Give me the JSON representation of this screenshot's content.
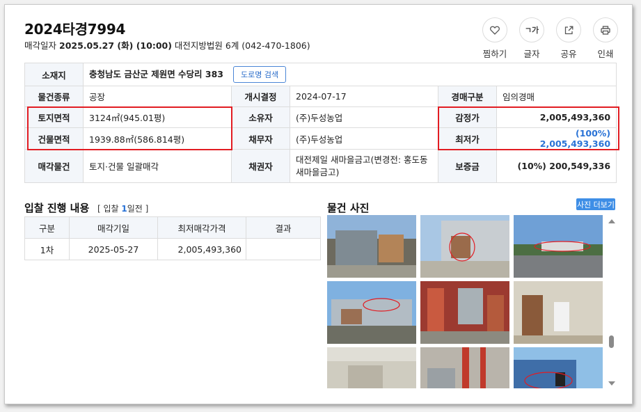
{
  "header": {
    "case_no": "2024타경7994",
    "sale_label": "매각일자",
    "sale_datetime": "2025.05.27 (화) (10:00)",
    "court": "대전지방법원 6계 (042-470-1806)"
  },
  "actions": [
    {
      "label": "찜하기",
      "icon": "heart-icon"
    },
    {
      "label": "글자",
      "icon": "text-size-icon",
      "glyph": "ㄱ가"
    },
    {
      "label": "공유",
      "icon": "share-icon"
    },
    {
      "label": "인쇄",
      "icon": "print-icon"
    }
  ],
  "info": {
    "address_label": "소재지",
    "address": "충청남도 금산군 제원면 수당리 383",
    "road_btn": "도로명 검색",
    "rows": [
      {
        "l1": "물건종류",
        "v1": "공장",
        "l2": "개시결정",
        "v2": "2024-07-17",
        "l3": "경매구분",
        "v3": "임의경매"
      },
      {
        "l1": "토지면적",
        "v1": "3124㎡(945.01평)",
        "l2": "소유자",
        "v2": "(주)두성농업",
        "l3": "감정가",
        "v3": "2,005,493,360"
      },
      {
        "l1": "건물면적",
        "v1": "1939.88㎡(586.814평)",
        "l2": "채무자",
        "v2": "(주)두성농업",
        "l3": "최저가",
        "v3": "(100%) 2,005,493,360"
      },
      {
        "l1": "매각물건",
        "v1": "토지·건물 일괄매각",
        "l2": "채권자",
        "v2": "대전제일 새마을금고(변경전: 홍도동 새마을금고)",
        "l3": "보증금",
        "v3": "(10%) 200,549,336"
      }
    ]
  },
  "bid": {
    "title": "입찰 진행 내용",
    "sub_prefix": "[ 입찰 ",
    "sub_count": "1",
    "sub_suffix": "일전 ]",
    "headers": [
      "구분",
      "매각기일",
      "최저매각가격",
      "결과"
    ],
    "rows": [
      [
        "1차",
        "2025-05-27",
        "2,005,493,360",
        ""
      ]
    ]
  },
  "photos": {
    "title": "물건 사진",
    "more": "사진 더보기"
  },
  "colors": {
    "accent": "#2a73d6",
    "highlight": "#e21c22",
    "header_bg": "#f3f6fa"
  }
}
